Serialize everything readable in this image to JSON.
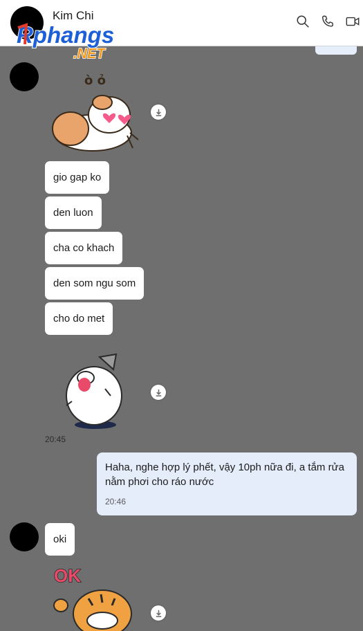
{
  "header": {
    "contact_name": "Kim Chi",
    "logo_text": "Rphangs",
    "logo_suffix": ".NET",
    "icons": [
      "search-icon",
      "phone-icon",
      "video-call-icon"
    ]
  },
  "messages": [
    {
      "type": "sticker",
      "sticker_caption": "ò ỏ",
      "sticker": "hamster-heart-eyes"
    },
    {
      "type": "text",
      "text": "gio gap ko"
    },
    {
      "type": "text",
      "text": "den luon"
    },
    {
      "type": "text",
      "text": "cha co khach"
    },
    {
      "type": "text",
      "text": "den som ngu som"
    },
    {
      "type": "text",
      "text": "cho do met"
    },
    {
      "type": "sticker",
      "sticker": "laughing-cat",
      "time": "20:45"
    },
    {
      "type": "text-out",
      "text": "Haha, nghe hợp lý phết, vậy 10ph nữa đi, a tắm rửa nằm phơi cho ráo nước",
      "time": "20:46"
    },
    {
      "type": "text",
      "text": "oki"
    },
    {
      "type": "sticker",
      "sticker_caption": "OK",
      "sticker": "tiger-ok"
    }
  ],
  "colors": {
    "chat_background": "#6f6f6f",
    "incoming_bubble": "#ffffff",
    "outgoing_bubble": "#e5edfb",
    "logo_red": "#e23a2b",
    "logo_blue": "#1d5fd6",
    "logo_orange": "#f39a1c"
  }
}
